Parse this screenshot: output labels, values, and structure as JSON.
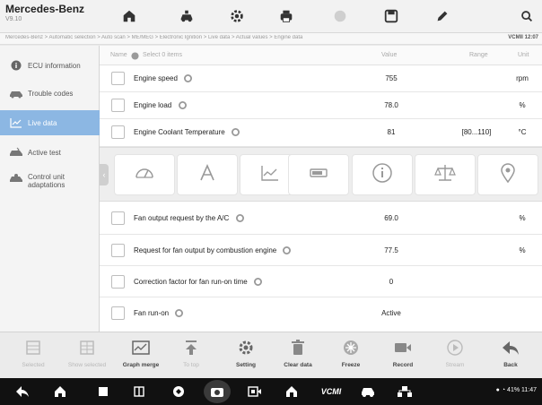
{
  "header": {
    "brand": "Mercedes-Benz",
    "version": "V9.10",
    "icons": [
      "home-icon",
      "car-service-icon",
      "settings-icon",
      "print-icon",
      "help-icon",
      "save-icon",
      "edit-icon",
      "search-icon"
    ]
  },
  "breadcrumb": {
    "path": "Mercedes-Benz > Automatic selection > Auto scan > ME/MEG > Electronic Ignition > Live data > Actual values > Engine data",
    "vcm": "VCMII",
    "time": "12:07"
  },
  "sidebar": {
    "items": [
      {
        "label": "ECU information",
        "icon": "info-icon"
      },
      {
        "label": "Trouble codes",
        "icon": "car-fault-icon"
      },
      {
        "label": "Live data",
        "icon": "chart-icon"
      },
      {
        "label": "Active test",
        "icon": "active-test-icon"
      },
      {
        "label": "Control unit adaptations",
        "icon": "adaptation-icon"
      }
    ]
  },
  "table": {
    "headers": {
      "name": "Name",
      "select": "Select 0 items",
      "value": "Value",
      "range": "Range",
      "unit": "Unit"
    },
    "rows_top": [
      {
        "name": "Engine speed",
        "value": "755",
        "range": "",
        "unit": "rpm"
      },
      {
        "name": "Engine load",
        "value": "78.0",
        "range": "",
        "unit": "%"
      },
      {
        "name": "Engine Coolant Temperature",
        "value": "81",
        "range": "[80...110]",
        "unit": "°C"
      }
    ],
    "rows_bottom": [
      {
        "name": "Fan output request by the A/C",
        "value": "69.0",
        "range": "",
        "unit": "%"
      },
      {
        "name": "Request for fan output by combustion engine",
        "value": "77.5",
        "range": "",
        "unit": "%"
      },
      {
        "name": "Correction factor for fan run-on time",
        "value": "0",
        "range": "",
        "unit": ""
      },
      {
        "name": "Fan run-on",
        "value": "Active",
        "range": "",
        "unit": ""
      }
    ]
  },
  "gauge_bar": {
    "collapse_glyph": "‹",
    "buttons": [
      "analog-gauge-icon",
      "digital-text-icon",
      "line-graph-icon",
      "bar-graph-icon",
      "info-icon",
      "balance-icon",
      "location-pin-icon"
    ]
  },
  "toolbar": {
    "buttons": [
      {
        "label": "Selected",
        "enabled": false
      },
      {
        "label": "Show selected",
        "enabled": false
      },
      {
        "label": "Graph merge",
        "enabled": true
      },
      {
        "label": "To top",
        "enabled": false
      },
      {
        "label": "Setting",
        "enabled": true
      },
      {
        "label": "Clear data",
        "enabled": true
      },
      {
        "label": "Freeze",
        "enabled": true
      },
      {
        "label": "Record",
        "enabled": true
      },
      {
        "label": "Stream",
        "enabled": false
      },
      {
        "label": "Back",
        "enabled": true
      }
    ]
  },
  "navbar": {
    "vcm_label": "VCMI",
    "status": "41% 11:47"
  },
  "colors": {
    "accent": "#8cb7e3",
    "navbar": "#111111"
  }
}
